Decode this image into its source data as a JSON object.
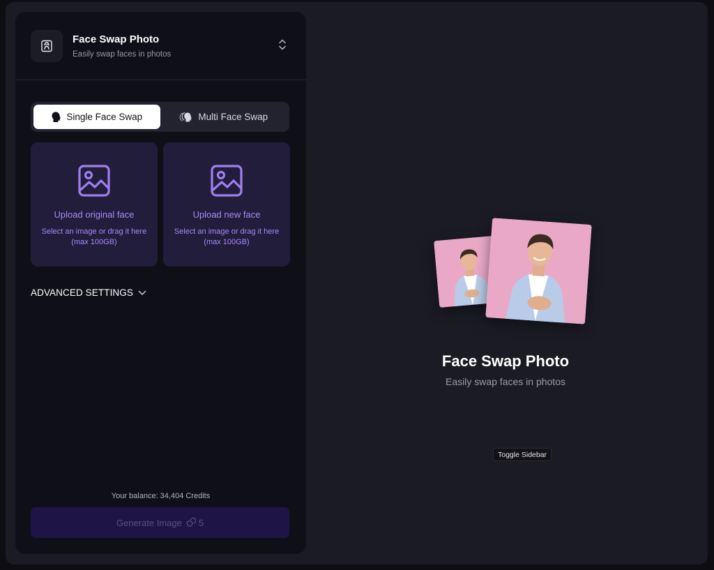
{
  "header": {
    "title": "Face Swap Photo",
    "subtitle": "Easily swap faces in photos",
    "app_icon": "face-swap-icon",
    "expand_icon": "chevron-up-down-icon"
  },
  "tabs": [
    {
      "label": "Single Face Swap",
      "icon": "single-face-icon",
      "active": true
    },
    {
      "label": "Multi Face Swap",
      "icon": "multi-face-icon",
      "active": false
    }
  ],
  "uploads": [
    {
      "title": "Upload original face",
      "desc_line1": "Select an image or drag it here",
      "desc_line2": "(max 100GB)",
      "icon": "image-icon"
    },
    {
      "title": "Upload new face",
      "desc_line1": "Select an image or drag it here",
      "desc_line2": "(max 100GB)",
      "icon": "image-icon"
    }
  ],
  "advanced": {
    "label": "ADVANCED SETTINGS",
    "icon": "chevron-down-icon"
  },
  "footer": {
    "balance": "Your balance: 34,404 Credits",
    "generate_label": "Generate Image",
    "generate_cost": "5",
    "cost_icon": "credits-icon"
  },
  "preview": {
    "title": "Face Swap Photo",
    "subtitle": "Easily swap faces in photos"
  },
  "tooltip": {
    "label": "Toggle Sidebar"
  },
  "colors": {
    "accent": "#a78bfa",
    "upload_bg": "#221d3b",
    "generate_bg": "#1e1446",
    "photo_bg": "#e9a9c6"
  }
}
